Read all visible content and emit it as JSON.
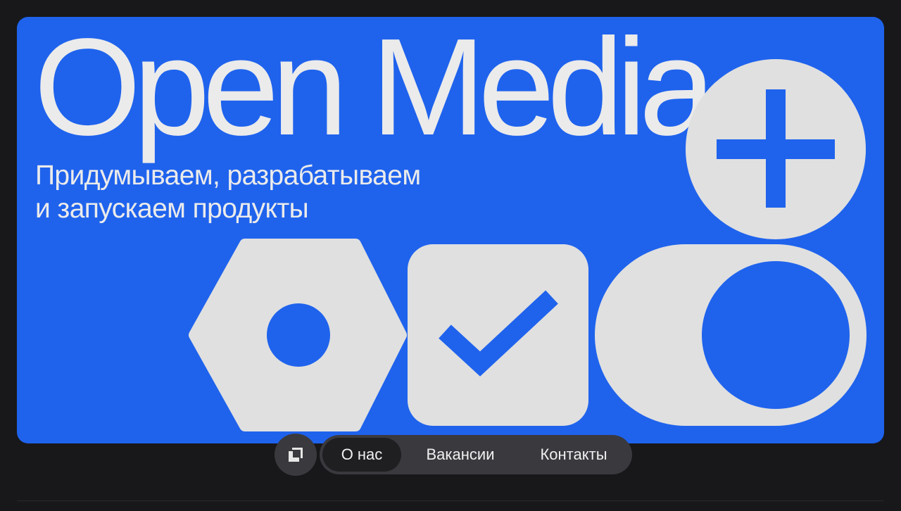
{
  "hero": {
    "title": "Open Media",
    "subtitle_line1": "Придумываем, разрабатываем",
    "subtitle_line2": "и запускаем продукты"
  },
  "icons": {
    "plus": "plus-icon",
    "hex_nut": "hex-nut-icon",
    "checkmark": "checkbox-check-icon",
    "toggle": "toggle-switch-icon",
    "logo": "open-media-logo-icon"
  },
  "nav": {
    "items": [
      {
        "label": "О нас",
        "active": true
      },
      {
        "label": "Вакансии",
        "active": false
      },
      {
        "label": "Контакты",
        "active": false
      }
    ]
  },
  "colors": {
    "background": "#18181a",
    "accent_blue": "#1f63ed",
    "shape_light": "#e0e0e0",
    "nav_pill": "#3a393e",
    "nav_active": "#1f1f22"
  }
}
